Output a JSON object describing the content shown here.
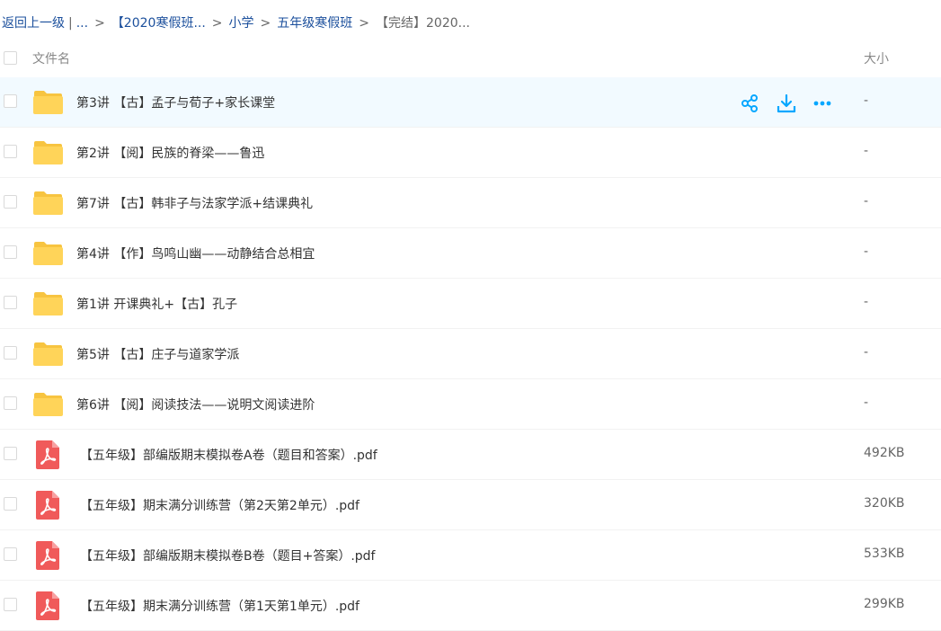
{
  "breadcrumb": {
    "back": "返回上一级",
    "bar": "|",
    "ellipsis": "...",
    "separator": ">",
    "items": [
      "【2020寒假班...",
      "小学",
      "五年级寒假班"
    ],
    "current": "【完结】2020..."
  },
  "header": {
    "col_name": "文件名",
    "col_size": "大小"
  },
  "colors": {
    "link": "#1b4f9c",
    "hover_row": "#f2faff",
    "folder": "#ffd459",
    "pdf": "#f05a5a",
    "action": "#06a7ff"
  },
  "rows": [
    {
      "type": "folder",
      "icon": "folder-icon",
      "name": "第3讲 【古】孟子与荀子+家长课堂",
      "size": "-"
    },
    {
      "type": "folder",
      "icon": "folder-icon",
      "name": "第2讲 【阅】民族的脊梁——鲁迅",
      "size": "-"
    },
    {
      "type": "folder",
      "icon": "folder-icon",
      "name": "第7讲 【古】韩非子与法家学派+结课典礼",
      "size": "-"
    },
    {
      "type": "folder",
      "icon": "folder-icon",
      "name": "第4讲 【作】鸟鸣山幽——动静结合总相宜",
      "size": "-"
    },
    {
      "type": "folder",
      "icon": "folder-icon",
      "name": "第1讲 开课典礼+【古】孔子",
      "size": "-"
    },
    {
      "type": "folder",
      "icon": "folder-icon",
      "name": "第5讲 【古】庄子与道家学派",
      "size": "-"
    },
    {
      "type": "folder",
      "icon": "folder-icon",
      "name": "第6讲 【阅】阅读技法——说明文阅读进阶",
      "size": "-"
    },
    {
      "type": "pdf",
      "icon": "pdf-icon",
      "name": "【五年级】部编版期末模拟卷A卷（题目和答案）.pdf",
      "size": "492KB"
    },
    {
      "type": "pdf",
      "icon": "pdf-icon",
      "name": "【五年级】期末满分训练营（第2天第2单元）.pdf",
      "size": "320KB"
    },
    {
      "type": "pdf",
      "icon": "pdf-icon",
      "name": "【五年级】部编版期末模拟卷B卷（题目+答案）.pdf",
      "size": "533KB"
    },
    {
      "type": "pdf",
      "icon": "pdf-icon",
      "name": "【五年级】期末满分训练营（第1天第1单元）.pdf",
      "size": "299KB"
    }
  ],
  "hover_actions": [
    "share-icon",
    "download-icon",
    "more-icon"
  ]
}
